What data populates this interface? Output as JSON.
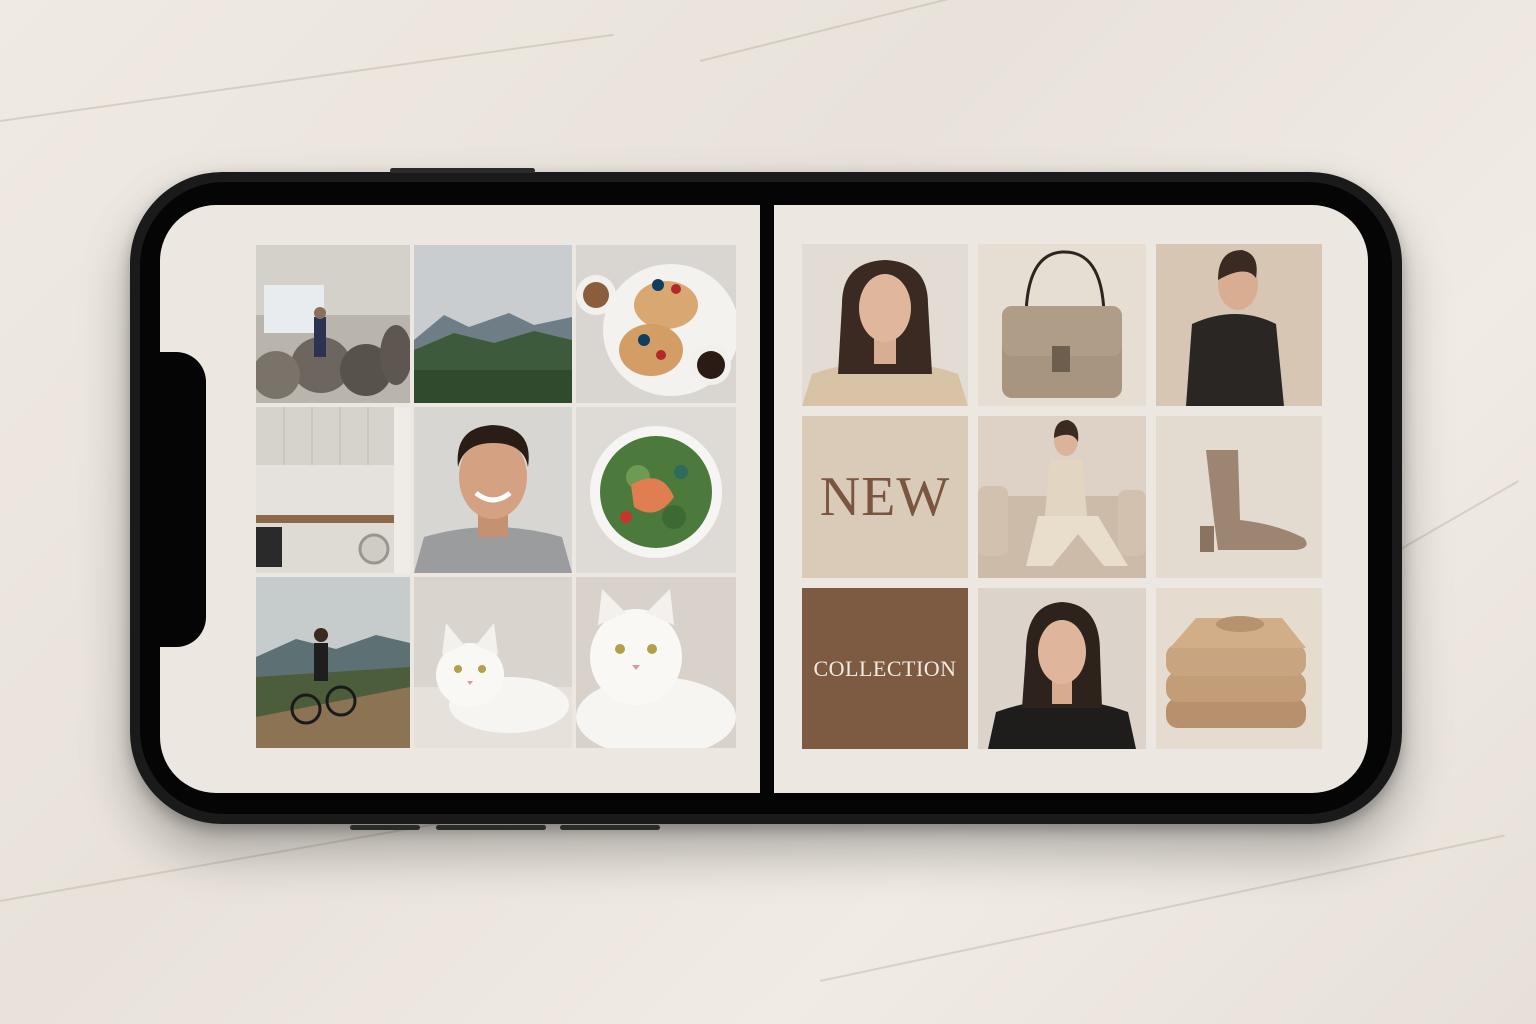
{
  "left_grid": {
    "tiles": [
      {
        "name": "blurred-presentation-photo"
      },
      {
        "name": "mountain-landscape-photo"
      },
      {
        "name": "pancakes-breakfast-photo"
      },
      {
        "name": "kitchen-interior-photo"
      },
      {
        "name": "smiling-man-portrait-photo"
      },
      {
        "name": "salad-bowl-photo"
      },
      {
        "name": "cyclist-hillside-photo"
      },
      {
        "name": "white-cat-photo"
      },
      {
        "name": "white-cat-closeup-photo"
      }
    ]
  },
  "right_grid": {
    "new_label": "NEW",
    "collection_label": "COLLECTION",
    "colors": {
      "accent_brown": "#7d5a42",
      "beige": "#d9cbb8",
      "cream": "#ece7e0"
    }
  }
}
